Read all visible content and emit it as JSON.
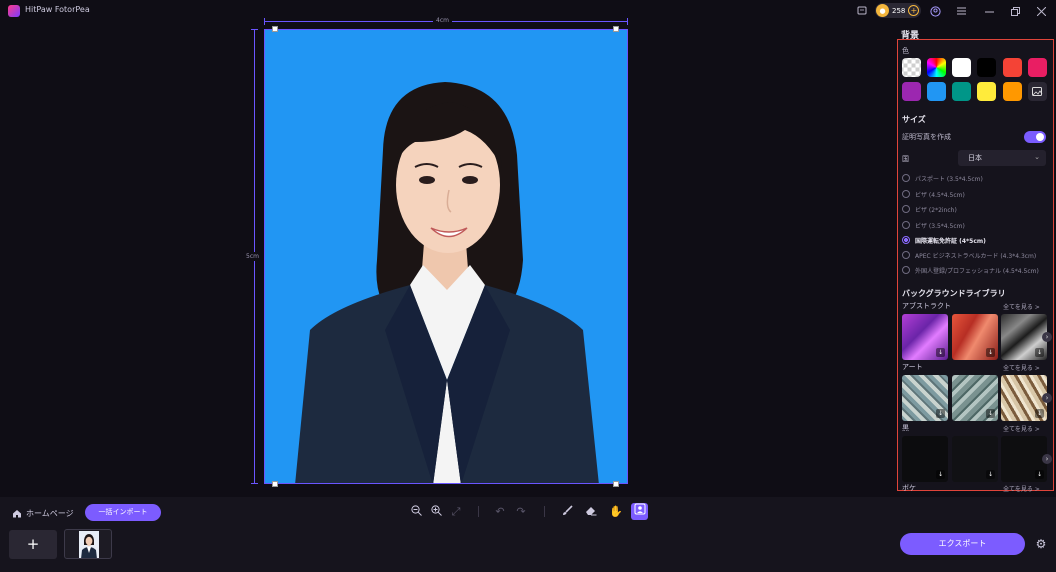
{
  "app": {
    "title": "HitPaw FotorPea"
  },
  "titlebar": {
    "credits": "258"
  },
  "canvas": {
    "width_label": "4cm",
    "height_label": "5cm"
  },
  "panel": {
    "header": "背景",
    "color_label": "色",
    "swatches": [
      "transparent",
      "rainbow",
      "#ffffff",
      "#000000",
      "#f44336",
      "#e91e63",
      "#9c27b0",
      "#2196f3",
      "#009688",
      "#ffeb3b",
      "#ff9800",
      "custom-image"
    ],
    "size_title": "サイズ",
    "id_photo_label": "証明写真を作成",
    "country_label": "国",
    "country_value": "日本",
    "sizes": [
      {
        "label": "パスポート (3.5*4.5cm)",
        "selected": false
      },
      {
        "label": "ビザ (4.5*4.5cm)",
        "selected": false
      },
      {
        "label": "ビザ (2*2inch)",
        "selected": false
      },
      {
        "label": "ビザ (3.5*4.5cm)",
        "selected": false
      },
      {
        "label": "国際運転免許証 (4*5cm)",
        "selected": true
      },
      {
        "label": "APEC ビジネストラベルカード (4.3*4.3cm)",
        "selected": false
      },
      {
        "label": "外国人登録/プロフェッショナル (4.5*4.5cm)",
        "selected": false
      }
    ],
    "library_title": "バックグラウンドライブラリ",
    "library_rows": [
      {
        "label": "アブストラクト",
        "see_all": "全てを見る >"
      },
      {
        "label": "アート",
        "see_all": "全てを見る >"
      },
      {
        "label": "黒",
        "see_all": "全てを見る >"
      },
      {
        "label": "ボケ",
        "see_all": "全てを見る >"
      }
    ]
  },
  "bottom": {
    "home_label": "ホームページ",
    "batch_import_label": "一括インポート",
    "add_label": "+",
    "export_label": "エクスポート"
  }
}
